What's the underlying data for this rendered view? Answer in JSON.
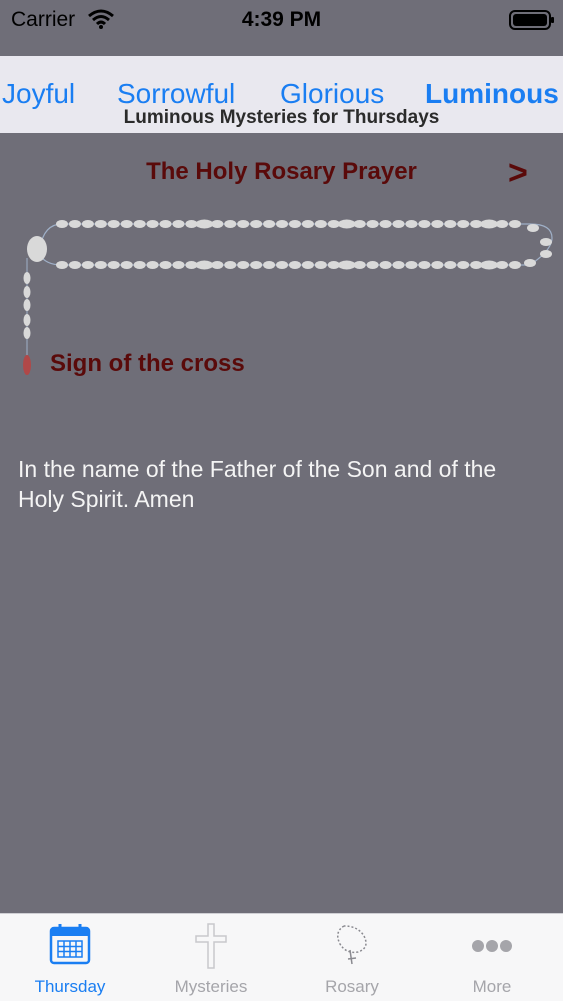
{
  "status": {
    "carrier": "Carrier",
    "time": "4:39 PM"
  },
  "segments": {
    "tabs": [
      {
        "label": "Joyful"
      },
      {
        "label": "Sorrowful"
      },
      {
        "label": "Glorious"
      },
      {
        "label": "Luminous"
      }
    ],
    "active": "Luminous",
    "subtitle": "Luminous Mysteries for Thursdays"
  },
  "prayer": {
    "title": "The Holy Rosary Prayer",
    "next_label": ">",
    "name": "Sign of the cross",
    "text": "In the name of the Father of the Son and of the Holy Spirit. Amen"
  },
  "tabbar": {
    "items": [
      {
        "label": "Thursday",
        "icon": "calendar-icon"
      },
      {
        "label": "Mysteries",
        "icon": "cross-icon"
      },
      {
        "label": "Rosary",
        "icon": "rosary-icon"
      },
      {
        "label": "More",
        "icon": "more-icon"
      }
    ],
    "active": "Thursday"
  },
  "colors": {
    "accent": "#1a7ef2",
    "prayer_title": "#5a0a0a",
    "background": "#6f6e78",
    "current_bead": "#b04848"
  }
}
